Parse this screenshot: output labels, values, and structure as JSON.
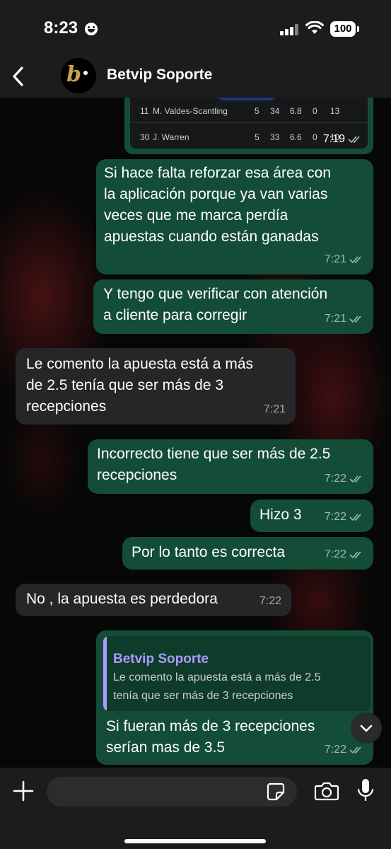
{
  "status_bar": {
    "time": "8:23",
    "battery": "100"
  },
  "header": {
    "contact_name": "Betvip Soporte",
    "avatar_letter": "b"
  },
  "table_preview": {
    "rows": [
      {
        "num": "11",
        "name": "M. Valdes-Scantling",
        "c1": "5",
        "c2": "34",
        "c3": "6.8",
        "c4": "0",
        "c5": "13"
      },
      {
        "num": "30",
        "name": "J. Warren",
        "c1": "5",
        "c2": "33",
        "c3": "6.6",
        "c4": "0",
        "c5": "10"
      }
    ],
    "time": "7:19"
  },
  "messages": [
    {
      "direction": "out",
      "lines": [
        "Si hace falta reforzar esa área con",
        "la aplicación porque ya van varias",
        "veces que me marca perdía",
        "apuestas cuando están ganadas"
      ],
      "time": "7:21"
    },
    {
      "direction": "out",
      "lines": [
        "Y tengo que verificar con atención",
        "a cliente para corregir"
      ],
      "time": "7:21"
    },
    {
      "direction": "in",
      "lines": [
        "Le comento la apuesta está a más",
        "de 2.5  tenía que ser más de 3",
        "recepciones"
      ],
      "time": "7:21"
    },
    {
      "direction": "out",
      "lines": [
        "Incorrecto tiene que ser más de 2.5",
        "recepciones"
      ],
      "time": "7:22"
    },
    {
      "direction": "out",
      "lines": [
        "Hizo 3"
      ],
      "time": "7:22"
    },
    {
      "direction": "out",
      "lines": [
        "Por lo tanto es correcta"
      ],
      "time": "7:22"
    },
    {
      "direction": "in",
      "lines": [
        "No , la apuesta es perdedora"
      ],
      "time": "7:22"
    },
    {
      "direction": "out",
      "lines": [
        "Si fueran más de 3 recepciones",
        "serían mas de 3.5"
      ],
      "time": "7:22",
      "reply_to": {
        "name": "Betvip Soporte",
        "lines": [
          "Le comento la apuesta está a más de 2.5",
          "tenía que ser más de 3 recepciones"
        ]
      }
    }
  ],
  "colors": {
    "outgoing": "#144d37",
    "incoming": "#262628",
    "quote_accent": "#a99bff"
  },
  "input_bar": {
    "placeholder": ""
  }
}
